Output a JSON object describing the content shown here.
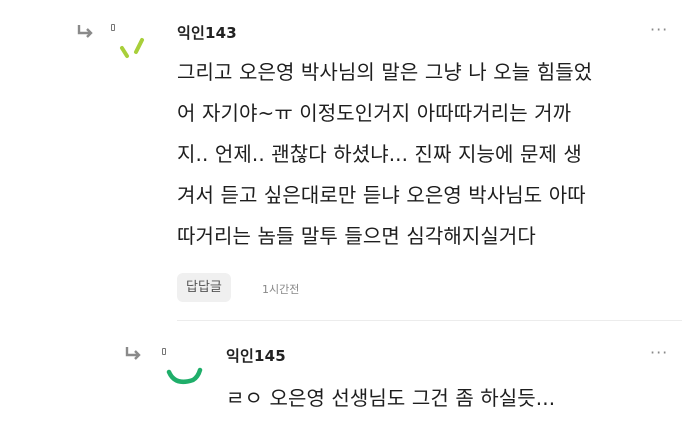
{
  "comments": [
    {
      "author": "익인143",
      "lines": [
        "그리고 오은영 박사님의 말은 그냥 나 오늘 힘들었",
        "어 자기야~ㅠ 이정도인거지 아따따거리는 거까",
        "지.. 언제.. 괜찮다 하셨냐... 진짜 지능에 문제 생",
        "겨서 듣고 싶은대로만 듣냐 오은영 박사님도 아따",
        "따거리는 놈들 말투 들으면 심각해지실거다"
      ],
      "reply_label": "답답글",
      "time": "1시간전",
      "more_icon": "more-dots-icon",
      "avatar_color": "#a8cf3a"
    },
    {
      "author": "익인145",
      "lines": [
        "ㄹㅇ 오은영 선생님도 그건 좀 하실듯..."
      ],
      "more_icon": "more-dots-icon",
      "avatar_color": "#1fae6a"
    }
  ],
  "colors": {
    "accent_lime": "#a8cf3a",
    "accent_green": "#1fae6a",
    "text": "#1e1e1e",
    "muted": "#888888"
  }
}
